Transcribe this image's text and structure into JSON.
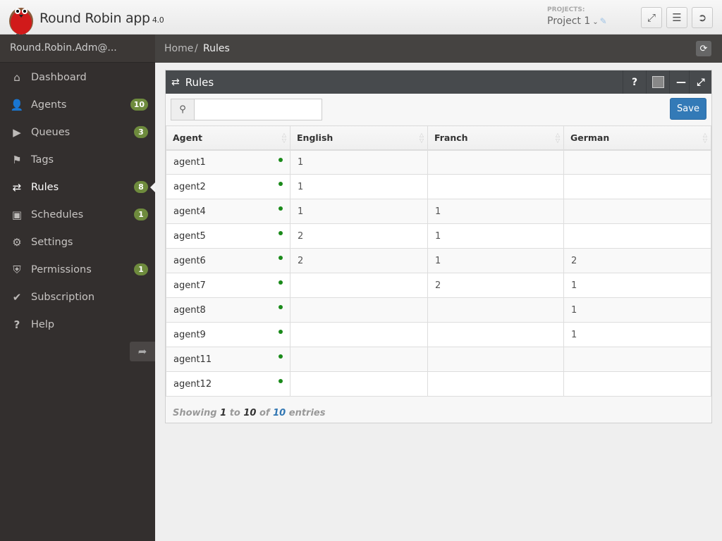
{
  "header": {
    "app_title": "Round Robin app",
    "app_version": "4.0",
    "projects_label": "PROJECTS:",
    "project_selected": "Project 1",
    "icons": {
      "fullscreen": "expand-arrows-icon",
      "menu": "hamburger-menu-icon",
      "logout": "sign-out-icon"
    }
  },
  "sidebar": {
    "user": "Round.Robin.Adm@...",
    "items": [
      {
        "label": "Dashboard",
        "icon": "home-icon",
        "badge": null
      },
      {
        "label": "Agents",
        "icon": "user-icon",
        "badge": "10"
      },
      {
        "label": "Queues",
        "icon": "play-circle-icon",
        "badge": "3"
      },
      {
        "label": "Tags",
        "icon": "tag-icon",
        "badge": null
      },
      {
        "label": "Rules",
        "icon": "shuffle-icon",
        "badge": "8",
        "active": true
      },
      {
        "label": "Schedules",
        "icon": "calendar-icon",
        "badge": "1"
      },
      {
        "label": "Settings",
        "icon": "gear-icon",
        "badge": null
      },
      {
        "label": "Permissions",
        "icon": "shield-icon",
        "badge": "1"
      },
      {
        "label": "Subscription",
        "icon": "check-icon",
        "badge": null
      },
      {
        "label": "Help",
        "icon": "question-icon",
        "badge": null
      }
    ]
  },
  "breadcrumb": {
    "home": "Home",
    "separator": "/",
    "current": "Rules"
  },
  "panel": {
    "title": "Rules",
    "search_value": "",
    "save_label": "Save",
    "table": {
      "columns": [
        "Agent",
        "English",
        "Franch",
        "German"
      ],
      "rows": [
        {
          "agent": "agent1",
          "online": true,
          "english": "1",
          "franch": "",
          "german": ""
        },
        {
          "agent": "agent2",
          "online": true,
          "english": "1",
          "franch": "",
          "german": ""
        },
        {
          "agent": "agent4",
          "online": true,
          "english": "1",
          "franch": "1",
          "german": ""
        },
        {
          "agent": "agent5",
          "online": true,
          "english": "2",
          "franch": "1",
          "german": ""
        },
        {
          "agent": "agent6",
          "online": true,
          "english": "2",
          "franch": "1",
          "german": "2"
        },
        {
          "agent": "agent7",
          "online": true,
          "english": "",
          "franch": "2",
          "german": "1"
        },
        {
          "agent": "agent8",
          "online": true,
          "english": "",
          "franch": "",
          "german": "1"
        },
        {
          "agent": "agent9",
          "online": true,
          "english": "",
          "franch": "",
          "german": "1"
        },
        {
          "agent": "agent11",
          "online": true,
          "english": "",
          "franch": "",
          "german": ""
        },
        {
          "agent": "agent12",
          "online": true,
          "english": "",
          "franch": "",
          "german": ""
        }
      ]
    },
    "info": {
      "showing": "Showing",
      "from": "1",
      "to_word": "to",
      "to": "10",
      "of_word": "of",
      "total": "10",
      "entries": "entries"
    }
  },
  "colors": {
    "badge": "#6e8b3d",
    "save": "#337ab7",
    "online_dot": "#1a8a1a",
    "sidebar": "#332f2e"
  }
}
